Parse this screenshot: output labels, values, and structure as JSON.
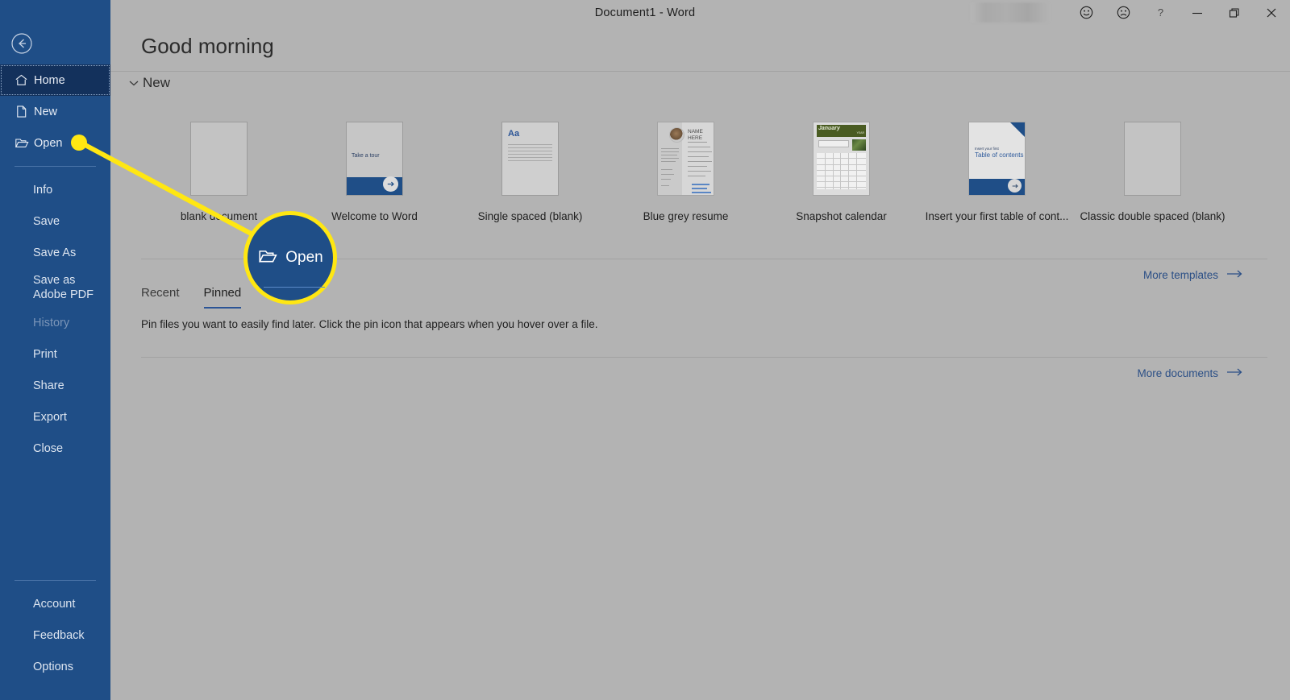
{
  "titlebar": {
    "document_title": "Document1  -  Word",
    "redacted_region": "account-name-blurred",
    "buttons": [
      {
        "name": "smiley-face-icon",
        "label": "Send a Smile"
      },
      {
        "name": "frowny-face-icon",
        "label": "Send a Frown"
      },
      {
        "name": "help-icon",
        "label": "?"
      },
      {
        "name": "minimize-icon",
        "label": "Minimize"
      },
      {
        "name": "restore-icon",
        "label": "Restore Down"
      },
      {
        "name": "close-icon",
        "label": "Close"
      }
    ]
  },
  "sidebar": {
    "back_label": "Back",
    "primary": [
      {
        "label": "Home",
        "icon": "home-icon",
        "selected": true
      },
      {
        "label": "New",
        "icon": "new-document-icon",
        "selected": false
      },
      {
        "label": "Open",
        "icon": "open-folder-icon",
        "selected": false
      }
    ],
    "secondary": [
      {
        "label": "Info",
        "disabled": false
      },
      {
        "label": "Save",
        "disabled": false
      },
      {
        "label": "Save As",
        "disabled": false
      },
      {
        "label": "Save as Adobe PDF",
        "disabled": false
      },
      {
        "label": "History",
        "disabled": true
      },
      {
        "label": "Print",
        "disabled": false
      },
      {
        "label": "Share",
        "disabled": false
      },
      {
        "label": "Export",
        "disabled": false
      },
      {
        "label": "Close",
        "disabled": false
      }
    ],
    "bottom": [
      {
        "label": "Account"
      },
      {
        "label": "Feedback"
      },
      {
        "label": "Options"
      }
    ]
  },
  "main": {
    "greeting": "Good morning",
    "new_section": {
      "title": "New",
      "chevron": "chevron-down-icon",
      "templates": [
        {
          "label": "blank document",
          "thumb": "blank-page"
        },
        {
          "label": "Welcome to Word",
          "thumb": "welcome-tour",
          "thumb_text": "Take a tour"
        },
        {
          "label": "Single spaced (blank)",
          "thumb": "single-spaced",
          "thumb_text": "Aa"
        },
        {
          "label": "Blue grey resume",
          "thumb": "resume",
          "thumb_text": "NAME HERE"
        },
        {
          "label": "Snapshot calendar",
          "thumb": "calendar",
          "thumb_text": "January",
          "thumb_year": "YEAR"
        },
        {
          "label": "Insert your first table of cont...",
          "thumb": "table-of-contents",
          "thumb_text_small": "Insert your first",
          "thumb_text_big": "Table of contents"
        },
        {
          "label": "Classic double spaced (blank)",
          "thumb": "blank-page"
        }
      ],
      "more_templates": "More templates"
    },
    "documents_section": {
      "tabs": [
        {
          "label": "Recent",
          "active": false
        },
        {
          "label": "Pinned",
          "active": true
        }
      ],
      "empty_message": "Pin files you want to easily find later. Click the pin icon that appears when you hover over a file.",
      "more_documents": "More documents"
    }
  },
  "callout": {
    "label": "Open",
    "icon": "open-folder-icon",
    "ring_color": "#ffe712",
    "fill_color": "#1f4e87",
    "pointer_target": "sidebar-item-open"
  },
  "colors": {
    "sidebar_blue": "#1f4e87",
    "sidebar_selected": "#13315c",
    "page_background": "#b3b3b3",
    "link_blue": "#2b4f86",
    "accent_yellow": "#ffe712"
  }
}
